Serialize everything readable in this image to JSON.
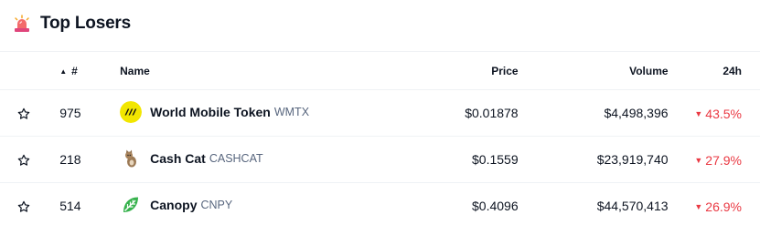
{
  "header": {
    "title": "Top Losers",
    "icon": "siren-icon"
  },
  "table": {
    "columns": {
      "rank": "#",
      "name": "Name",
      "price": "Price",
      "volume": "Volume",
      "change": "24h"
    },
    "sort_indicator": "▲",
    "rows": [
      {
        "rank": "975",
        "name": "World Mobile Token",
        "symbol": "WMTX",
        "price": "$0.01878",
        "volume": "$4,498,396",
        "change": "43.5%",
        "logo": "world-mobile-token-logo"
      },
      {
        "rank": "218",
        "name": "Cash Cat",
        "symbol": "CASHCAT",
        "price": "$0.1559",
        "volume": "$23,919,740",
        "change": "27.9%",
        "logo": "cash-cat-logo"
      },
      {
        "rank": "514",
        "name": "Canopy",
        "symbol": "CNPY",
        "price": "$0.4096",
        "volume": "$44,570,413",
        "change": "26.9%",
        "logo": "canopy-logo"
      }
    ]
  },
  "colors": {
    "negative": "#ea3943",
    "muted": "#58667e",
    "text": "#0d1421"
  }
}
